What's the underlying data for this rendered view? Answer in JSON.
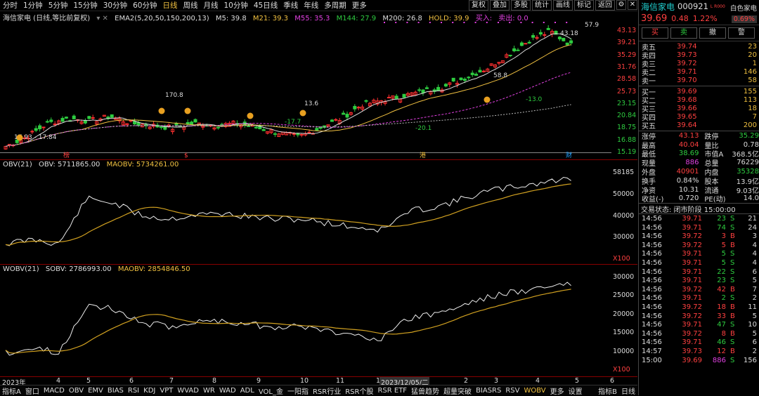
{
  "timeframes": [
    "分时",
    "1分钟",
    "5分钟",
    "15分钟",
    "30分钟",
    "60分钟",
    "日线",
    "周线",
    "月线",
    "10分钟",
    "45日线",
    "季线",
    "年线",
    "多周期",
    "更多"
  ],
  "active_timeframe": "日线",
  "top_right_buttons": [
    "复权",
    "叠加",
    "多股",
    "统计",
    "画线",
    "标记",
    "返回"
  ],
  "stock_header": {
    "name": "海信家电 (日线,等比前复权)",
    "ema_label": "EMA2(5,20,50,150,200,13)",
    "ma5": "M5: 39.8",
    "ma21": "M21: 39.3",
    "ma55": "M55: 35.3",
    "ma144": "M144: 27.9",
    "ma200": "M200: 26.8",
    "hold": "HOLD: 39.9",
    "buy": "买入: ",
    "sell": "卖出: 0.0"
  },
  "price_axis": [
    "43.13",
    "39.21",
    "35.29",
    "31.76",
    "28.58",
    "25.73",
    "23.15",
    "20.84",
    "18.75",
    "16.88",
    "15.19"
  ],
  "annotations": {
    "high": "43.18",
    "peak": "57.9",
    "a1": "170.8",
    "a2": "13.6",
    "a3": "58.8",
    "a4": "-13.0",
    "a5": "-17.7",
    "a6": "-20.1",
    "low": "17.93 - 17.84"
  },
  "markers": [
    "榜",
    "$",
    "港",
    "财"
  ],
  "obv_header": {
    "name": "OBV(21)",
    "obv": "OBV: 5711865.00",
    "maobv": "MAOBV: 5734261.00"
  },
  "obv_axis": [
    "58185",
    "50000",
    "40000",
    "30000",
    "X100"
  ],
  "wobv_header": {
    "name": "WOBV(21)",
    "sobv": "SOBV: 2786993.00",
    "maobv": "MAOBV: 2854846.50"
  },
  "wobv_axis": [
    "30000",
    "25000",
    "20000",
    "15000",
    "10000",
    "X100"
  ],
  "time_axis": [
    "2023年",
    "4",
    "5",
    "6",
    "7",
    "8",
    "9",
    "10",
    "11",
    "1",
    "2023/12/05/二",
    "2",
    "3",
    "4",
    "5",
    "6"
  ],
  "bottom_tabs": [
    "指标A",
    "窗口",
    "MACD",
    "OBV",
    "EMV",
    "BIAS",
    "RSI",
    "KDJ",
    "VPT",
    "WVAD",
    "WR",
    "WAD",
    "ADL",
    "VOL_金",
    "一阳指",
    "RSR行业",
    "RSR个股",
    "RSR ETF",
    "猛兽趋势",
    "超量突破",
    "BIASRS",
    "RSV",
    "WOBV",
    "更多",
    "设置"
  ],
  "bottom_right": [
    "指标B",
    "日线"
  ],
  "quote": {
    "title": "海信家电",
    "code": "000921",
    "flag": "L R000",
    "board": "白色家电",
    "board_pct": "0.69%",
    "price": "39.69",
    "change": "0.48",
    "pct": "1.22%",
    "actions": [
      "买",
      "卖",
      "撤",
      "警"
    ],
    "asks": [
      [
        "卖五",
        "39.74",
        "23"
      ],
      [
        "卖四",
        "39.73",
        "20"
      ],
      [
        "卖三",
        "39.72",
        "1"
      ],
      [
        "卖二",
        "39.71",
        "146"
      ],
      [
        "卖一",
        "39.70",
        "58"
      ]
    ],
    "bids": [
      [
        "买一",
        "39.69",
        "155"
      ],
      [
        "买二",
        "39.68",
        "113"
      ],
      [
        "买三",
        "39.66",
        "18"
      ],
      [
        "买四",
        "39.65",
        "7"
      ],
      [
        "买五",
        "39.64",
        "200"
      ]
    ],
    "stats": [
      [
        "涨停",
        "43.13",
        "跌停",
        "35.29"
      ],
      [
        "最高",
        "40.04",
        "量比",
        "0.78"
      ],
      [
        "最低",
        "38.69",
        "市值A",
        "368.5亿"
      ],
      [
        "现量",
        "886",
        "总量",
        "76229"
      ],
      [
        "外盘",
        "40901",
        "内盘",
        "35328"
      ],
      [
        "换手",
        "0.84%",
        "股本",
        "13.9亿"
      ],
      [
        "净资",
        "10.31",
        "流通",
        "9.03亿"
      ],
      [
        "收益(-)",
        "0.720",
        "PE(动)",
        "14.0"
      ]
    ],
    "trade_status": "交易状态: 闭市阶段 15:00:00",
    "trades": [
      [
        "14:56",
        "39.71",
        "23",
        "S",
        "21"
      ],
      [
        "14:56",
        "39.71",
        "74",
        "S",
        "24"
      ],
      [
        "14:56",
        "39.72",
        "3",
        "B",
        "3"
      ],
      [
        "14:56",
        "39.72",
        "5",
        "B",
        "4"
      ],
      [
        "14:56",
        "39.71",
        "5",
        "S",
        "4"
      ],
      [
        "14:56",
        "39.71",
        "5",
        "S",
        "4"
      ],
      [
        "14:56",
        "39.71",
        "22",
        "S",
        "6"
      ],
      [
        "14:56",
        "39.71",
        "23",
        "S",
        "5"
      ],
      [
        "14:56",
        "39.72",
        "42",
        "B",
        "7"
      ],
      [
        "14:56",
        "39.71",
        "2",
        "S",
        "2"
      ],
      [
        "14:56",
        "39.72",
        "18",
        "B",
        "11"
      ],
      [
        "14:56",
        "39.72",
        "33",
        "B",
        "5"
      ],
      [
        "14:56",
        "39.71",
        "47",
        "S",
        "10"
      ],
      [
        "14:56",
        "39.72",
        "8",
        "B",
        "5"
      ],
      [
        "14:56",
        "39.71",
        "46",
        "S",
        "6"
      ],
      [
        "14:57",
        "39.73",
        "12",
        "B",
        "2"
      ],
      [
        "15:00",
        "39.69",
        "886",
        "S",
        "156"
      ]
    ]
  }
}
